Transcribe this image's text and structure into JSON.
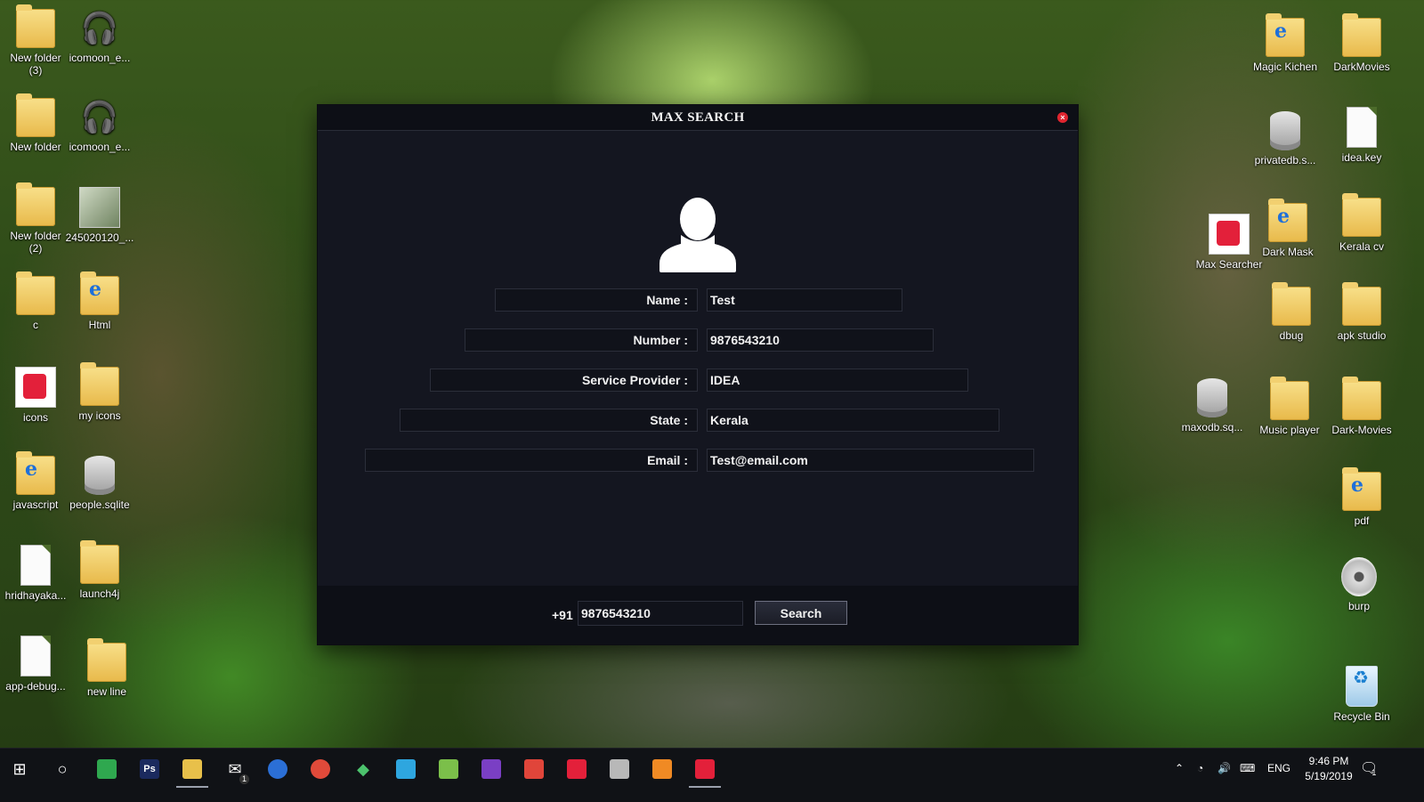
{
  "desktop": {
    "left_icons": [
      {
        "label": "New folder\n(3)",
        "icon": "folder-icon"
      },
      {
        "label": "icomoon_e...",
        "icon": "headphones-icon"
      },
      {
        "label": "New folder",
        "icon": "folder-icon"
      },
      {
        "label": "icomoon_e...",
        "icon": "headphones-icon"
      },
      {
        "label": "New folder\n(2)",
        "icon": "folder-icon"
      },
      {
        "label": "245020120_...",
        "icon": "photo-icon"
      },
      {
        "label": "c",
        "icon": "folder-icon"
      },
      {
        "label": "Html",
        "icon": "ie-folder-icon"
      },
      {
        "label": "icons",
        "icon": "red-folder-icon"
      },
      {
        "label": "my icons",
        "icon": "folder-icon"
      },
      {
        "label": "javascript",
        "icon": "ie-folder-icon"
      },
      {
        "label": "people.sqlite",
        "icon": "database-icon"
      },
      {
        "label": "hridhayaka...",
        "icon": "document-icon"
      },
      {
        "label": "launch4j",
        "icon": "folder-icon"
      },
      {
        "label": "app-debug...",
        "icon": "document-icon"
      },
      {
        "label": "new line",
        "icon": "folder-icon"
      }
    ],
    "right_icons": [
      {
        "label": "Magic Kichen",
        "icon": "ie-folder-icon"
      },
      {
        "label": "DarkMovies",
        "icon": "folder-icon"
      },
      {
        "label": "privatedb.s...",
        "icon": "database-icon"
      },
      {
        "label": "idea.key",
        "icon": "document-icon"
      },
      {
        "label": "Max Searcher",
        "icon": "max-searcher-icon"
      },
      {
        "label": "Dark Mask",
        "icon": "ie-folder-icon"
      },
      {
        "label": "Kerala cv",
        "icon": "folder-icon"
      },
      {
        "label": "dbug",
        "icon": "folder-icon"
      },
      {
        "label": "apk studio",
        "icon": "folder-icon"
      },
      {
        "label": "maxodb.sq...",
        "icon": "database-icon"
      },
      {
        "label": "Music player",
        "icon": "folder-icon"
      },
      {
        "label": "Dark-Movies",
        "icon": "folder-icon"
      },
      {
        "label": "pdf",
        "icon": "ie-folder-icon"
      },
      {
        "label": "burp",
        "icon": "disc-icon"
      },
      {
        "label": "Recycle Bin",
        "icon": "recycle-bin-icon"
      }
    ]
  },
  "dialog": {
    "title": "MAX SEARCH",
    "close_symbol": "×",
    "fields": [
      {
        "label": "Name :",
        "value": "Test"
      },
      {
        "label": "Number :",
        "value": "9876543210"
      },
      {
        "label": "Service Provider :",
        "value": "IDEA"
      },
      {
        "label": "State :",
        "value": "Kerala"
      },
      {
        "label": "Email :",
        "value": "Test@email.com"
      }
    ],
    "footer": {
      "prefix": "+91",
      "search_value": "9876543210",
      "search_button": "Search"
    }
  },
  "taskbar": {
    "items": [
      {
        "name": "windows-start-icon"
      },
      {
        "name": "cortana-search-icon"
      },
      {
        "name": "app-green-icon"
      },
      {
        "name": "photoshop-icon",
        "text": "Ps"
      },
      {
        "name": "file-explorer-icon"
      },
      {
        "name": "mail-icon",
        "badge": "1"
      },
      {
        "name": "firefox-icon"
      },
      {
        "name": "chrome-icon"
      },
      {
        "name": "app-diamond-icon"
      },
      {
        "name": "telegram-icon"
      },
      {
        "name": "notepad-icon"
      },
      {
        "name": "visual-studio-icon"
      },
      {
        "name": "app-red-icon"
      },
      {
        "name": "max-searcher-icon"
      },
      {
        "name": "database-icon"
      },
      {
        "name": "sublime-icon"
      },
      {
        "name": "max-searcher-active-icon"
      }
    ],
    "tray": {
      "language": "ENG",
      "time": "9:46 PM",
      "date": "5/19/2019",
      "notification_badge": "1"
    }
  },
  "colors": {
    "dialog_bg": "#141620",
    "titlebar_bg": "#0d0f16",
    "close_red": "#e0252f",
    "taskbar_bg": "#101216"
  }
}
